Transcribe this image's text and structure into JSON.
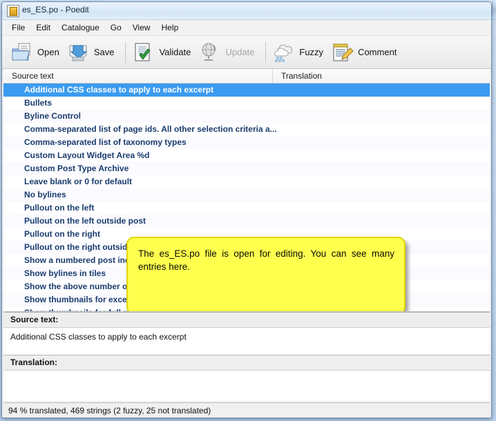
{
  "window": {
    "title": "es_ES.po - Poedit",
    "app_icon": "document-icon",
    "restore_button": "restore-window-button"
  },
  "menubar": {
    "items": [
      {
        "label": "File"
      },
      {
        "label": "Edit"
      },
      {
        "label": "Catalogue"
      },
      {
        "label": "Go"
      },
      {
        "label": "View"
      },
      {
        "label": "Help"
      }
    ]
  },
  "toolbar": {
    "buttons": [
      {
        "label": "Open",
        "icon": "open-folder-icon",
        "disabled": false
      },
      {
        "label": "Save",
        "icon": "save-disk-icon",
        "disabled": false
      },
      {
        "label": "Validate",
        "icon": "validate-check-icon",
        "disabled": false
      },
      {
        "label": "Update",
        "icon": "update-globe-icon",
        "disabled": true
      },
      {
        "label": "Fuzzy",
        "icon": "fuzzy-cloud-icon",
        "disabled": false
      },
      {
        "label": "Comment",
        "icon": "comment-notepad-icon",
        "disabled": false
      }
    ]
  },
  "columns": {
    "source": "Source text",
    "translation": "Translation"
  },
  "entries": [
    {
      "source": "Additional CSS classes to apply to each excerpt",
      "translation": "",
      "selected": true
    },
    {
      "source": "Bullets",
      "translation": "",
      "selected": false
    },
    {
      "source": "Byline Control",
      "translation": "",
      "selected": false
    },
    {
      "source": "Comma-separated list of page ids. All other selection criteria a...",
      "translation": "",
      "selected": false
    },
    {
      "source": "Comma-separated list of taxonomy types",
      "translation": "",
      "selected": false
    },
    {
      "source": "Custom Layout Widget Area %d",
      "translation": "",
      "selected": false
    },
    {
      "source": "Custom Post Type Archive",
      "translation": "",
      "selected": false
    },
    {
      "source": "Leave blank or 0 for default",
      "translation": "",
      "selected": false
    },
    {
      "source": "No bylines",
      "translation": "",
      "selected": false
    },
    {
      "source": "Pullout on the left",
      "translation": "",
      "selected": false
    },
    {
      "source": "Pullout on the left outside post",
      "translation": "",
      "selected": false
    },
    {
      "source": "Pullout on the right",
      "translation": "",
      "selected": false
    },
    {
      "source": "Pullout on the right outside post",
      "translation": "",
      "selected": false
    },
    {
      "source": "Show a numbered post index",
      "translation": "",
      "selected": false
    },
    {
      "source": "Show bylines in tiles",
      "translation": "",
      "selected": false
    },
    {
      "source": "Show the above number of full posts on all pages, not just the...",
      "translation": "",
      "selected": false
    },
    {
      "source": "Show thumbnails for excerpts",
      "translation": "",
      "selected": false
    },
    {
      "source": "Show thumbnails for full posts in the archive",
      "translation": "",
      "selected": false
    }
  ],
  "source_pane": {
    "label": "Source text:",
    "value": "Additional CSS classes to apply to each excerpt"
  },
  "translation_pane": {
    "label": "Translation:",
    "value": ""
  },
  "statusbar": {
    "text": "94 % translated, 469 strings (2 fuzzy, 25 not translated)"
  },
  "tooltip": {
    "text": "The es_ES.po file is open for editing. You can see many entries here."
  },
  "colors": {
    "selection_blue": "#3a9bf0",
    "entry_text_blue": "#1a3c6e",
    "tooltip_yellow": "#ffff4d",
    "tooltip_border": "#e0d400"
  }
}
